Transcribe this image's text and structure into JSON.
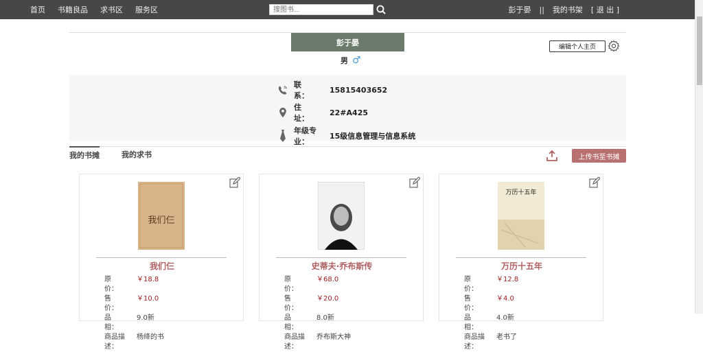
{
  "nav": {
    "items": [
      "首页",
      "书籍良品",
      "求书区",
      "服务区"
    ]
  },
  "search": {
    "placeholder": "搜图书..."
  },
  "user_nav": {
    "username": "彭于晏",
    "sep": "||",
    "shelf": "我的书架",
    "logout": "[ 退 出 ]"
  },
  "profile": {
    "name": "彭于晏",
    "gender": "男",
    "gender_symbol": "♂",
    "edit_label": "编辑个人主页",
    "phone_label": "联　　系：",
    "phone": "15815403652",
    "address_label": "住　　址：",
    "address": "22#A425",
    "major_label": "年级专业：",
    "major": "15级信息管理与信息系统"
  },
  "tabs": {
    "stall": "我的书摊",
    "wanted": "我的求书",
    "upload_label": "上传书至书摊"
  },
  "books": [
    {
      "title": "我们仨",
      "orig_label": "原　　价：",
      "orig": "￥18.8",
      "sale_label": "售　　价：",
      "sale": "￥10.0",
      "cond_label": "品　　相：",
      "cond": "9.0新",
      "desc_label": "商品描述：",
      "desc": "杨绛的书",
      "cover_text": "我们仨"
    },
    {
      "title": "史蒂夫·乔布斯传",
      "orig_label": "原　　价：",
      "orig": "￥68.0",
      "sale_label": "售　　价：",
      "sale": "￥20.0",
      "cond_label": "品　　相：",
      "cond": "8.0新",
      "desc_label": "商品描述：",
      "desc": "乔布斯大神",
      "cover_text": ""
    },
    {
      "title": "万历十五年",
      "orig_label": "原　　价：",
      "orig": "￥12.8",
      "sale_label": "售　　价：",
      "sale": "￥4.0",
      "cond_label": "品　　相：",
      "cond": "4.0新",
      "desc_label": "商品描述：",
      "desc": "老书了",
      "cover_text": "万历十五年"
    }
  ],
  "colors": {
    "topbar": "#474747",
    "name_box": "#6b7b6b",
    "accent": "#b87070",
    "price": "#a02020"
  }
}
